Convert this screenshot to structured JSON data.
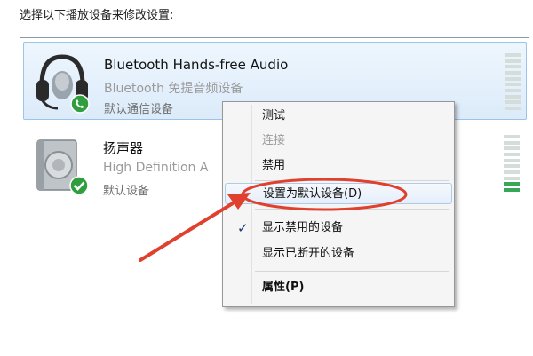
{
  "instruction": "选择以下播放设备来修改设置:",
  "devices": [
    {
      "name": "Bluetooth Hands-free Audio",
      "subtitle": "Bluetooth 免提音频设备",
      "status": "默认通信设备",
      "icon": "headset-icon",
      "badge": "phone-icon",
      "selected": true
    },
    {
      "name": "扬声器",
      "subtitle": "High Definition A",
      "status": "默认设备",
      "icon": "speaker-icon",
      "badge": "check-icon",
      "selected": false
    }
  ],
  "context_menu": {
    "items": [
      {
        "label": "测试",
        "enabled": true
      },
      {
        "label": "连接",
        "enabled": false
      },
      {
        "label": "禁用",
        "enabled": true
      },
      {
        "label": "设置为默认设备(D)",
        "enabled": true,
        "hovered": true
      },
      {
        "label": "显示禁用的设备",
        "enabled": true,
        "checked": true
      },
      {
        "label": "显示已断开的设备",
        "enabled": true
      },
      {
        "label": "属性(P)",
        "enabled": true,
        "bold": true
      }
    ]
  },
  "colors": {
    "selection": "#dcebfa",
    "annotation": "#e0412f",
    "level_on": "#3aa657",
    "badge_green": "#2e9e3e"
  }
}
